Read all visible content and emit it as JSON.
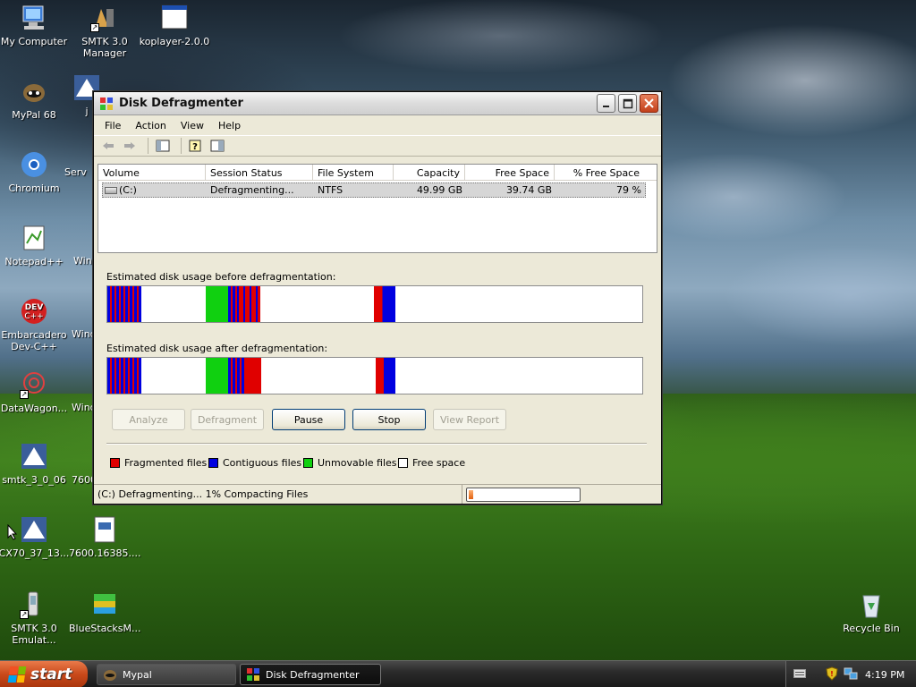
{
  "desktop": {
    "icons": [
      {
        "label": "My Computer"
      },
      {
        "label": "SMTK 3.0 Manager"
      },
      {
        "label": "koplayer-2.0.0"
      },
      {
        "label": "MyPal 68"
      },
      {
        "label": "j"
      },
      {
        "label": "Chromium"
      },
      {
        "label": "Serv"
      },
      {
        "label": "Notepad++"
      },
      {
        "label": "Wind"
      },
      {
        "label": "Embarcadero Dev-C++"
      },
      {
        "label": "Wind"
      },
      {
        "label": "DataWagon..."
      },
      {
        "label": "Wind"
      },
      {
        "label": "smtk_3_0_06"
      },
      {
        "label": "7600"
      },
      {
        "label": "CX70_37_13..."
      },
      {
        "label": "7600.16385...."
      },
      {
        "label": "SMTK 3.0 Emulat..."
      },
      {
        "label": "BlueStacksM..."
      },
      {
        "label": "Recycle Bin"
      }
    ]
  },
  "window": {
    "title": "Disk Defragmenter",
    "menu": [
      "File",
      "Action",
      "View",
      "Help"
    ],
    "columns": [
      "Volume",
      "Session Status",
      "File System",
      "Capacity",
      "Free Space",
      "% Free Space"
    ],
    "rows": [
      {
        "volume": "(C:)",
        "status": "Defragmenting...",
        "fs": "NTFS",
        "capacity": "49.99 GB",
        "free": "39.74 GB",
        "pct": "79 %"
      }
    ],
    "before_label": "Estimated disk usage before defragmentation:",
    "after_label": "Estimated disk usage after defragmentation:",
    "buttons": {
      "analyze": "Analyze",
      "defragment": "Defragment",
      "pause": "Pause",
      "stop": "Stop",
      "view_report": "View Report"
    },
    "legend": {
      "fragmented": "Fragmented files",
      "contiguous": "Contiguous files",
      "unmovable": "Unmovable files",
      "free": "Free space"
    },
    "status_text": "(C:) Defragmenting... 1%  Compacting Files",
    "progress_fraction": 0.04
  },
  "colors": {
    "fragmented": "#e00000",
    "contiguous": "#0000e0",
    "unmovable": "#10d010",
    "free": "#ffffff"
  },
  "taskbar": {
    "start_label": "start",
    "tasks": [
      {
        "label": "Mypal"
      },
      {
        "label": "Disk Defragmenter"
      }
    ],
    "clock": "4:19 PM"
  }
}
